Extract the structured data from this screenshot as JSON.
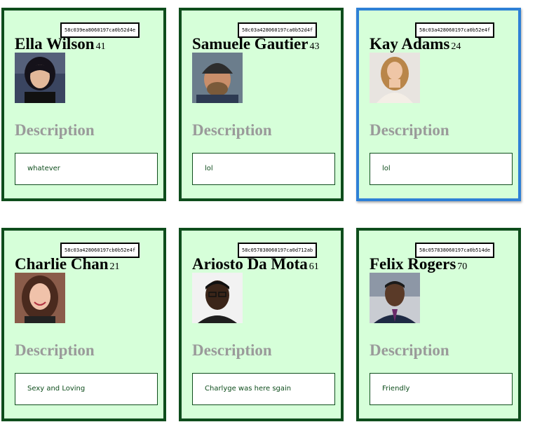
{
  "section_title": "Description",
  "profiles": [
    {
      "id": "58c039ea8060197ca0b52d4e",
      "name": "Ella Wilson",
      "age": "41",
      "description": "whatever",
      "avatar": "female-avatar"
    },
    {
      "id": "58c03a428060197ca0b52d4f",
      "name": "Samuele Gautier",
      "age": "43",
      "description": "lol",
      "avatar": "male-avatar"
    },
    {
      "id": "58c03a428060197ca0b52e4f",
      "name": "Kay Adams",
      "age": "24",
      "description": "lol",
      "avatar": "female-avatar"
    },
    {
      "id": "58c03a428060197cb0b52e4f",
      "name": "Charlie Chan",
      "age": "21",
      "description": "Sexy and Loving",
      "avatar": "female-avatar"
    },
    {
      "id": "58c057838060197ca0d712ab",
      "name": "Ariosto Da Mota",
      "age": "61",
      "description": "Charlyge was here sgain",
      "avatar": "male-avatar"
    },
    {
      "id": "58c057838060197ca0b514de",
      "name": "Felix Rogers",
      "age": "70",
      "description": "Friendly",
      "avatar": "male-avatar"
    }
  ],
  "colors": {
    "card_bg": "#d6ffd9",
    "card_border": "#0e4d1c",
    "selected_border": "#2e80d6",
    "description_heading": "#9a9a9a"
  },
  "selected_index": 2
}
